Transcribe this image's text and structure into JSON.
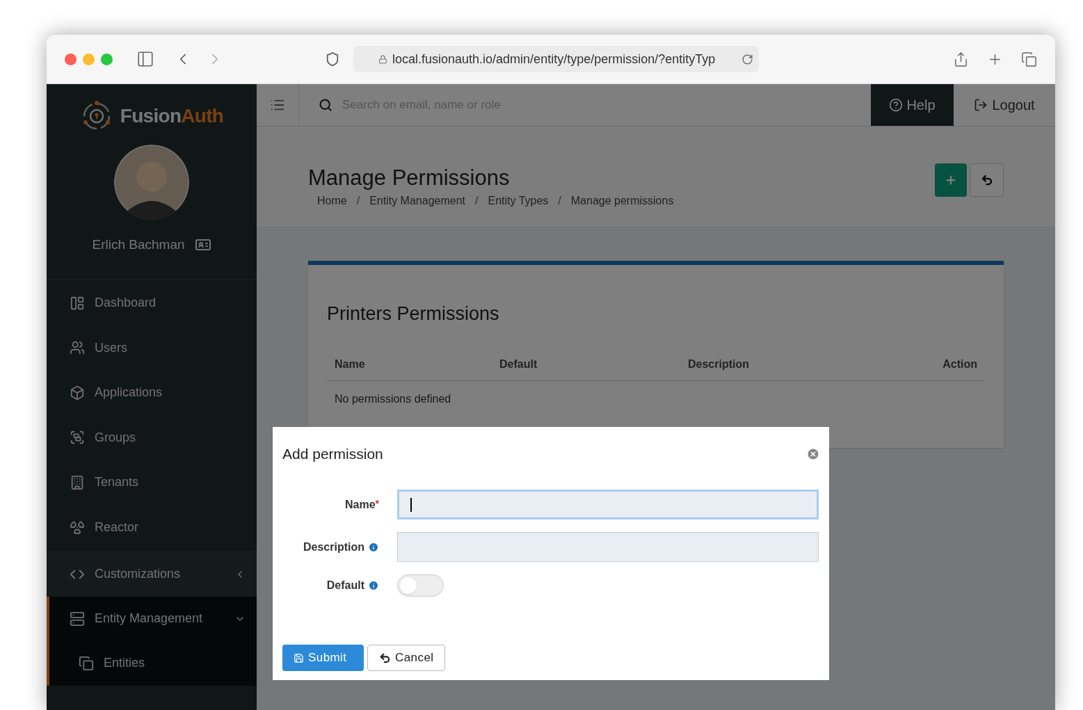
{
  "browser": {
    "url": "local.fusionauth.io/admin/entity/type/permission/?entityTyp"
  },
  "sidebar": {
    "brand": {
      "first": "Fusion",
      "second": "Auth"
    },
    "user_name": "Erlich Bachman",
    "items": [
      {
        "label": "Dashboard"
      },
      {
        "label": "Users"
      },
      {
        "label": "Applications"
      },
      {
        "label": "Groups"
      },
      {
        "label": "Tenants"
      },
      {
        "label": "Reactor"
      }
    ],
    "sections": [
      {
        "label": "Customizations",
        "expanded": false
      },
      {
        "label": "Entity Management",
        "expanded": true,
        "children": [
          {
            "label": "Entities"
          }
        ]
      }
    ]
  },
  "topbar": {
    "search": {
      "placeholder": "Search on email, name or role"
    },
    "help": "Help",
    "logout": "Logout"
  },
  "page": {
    "title": "Manage Permissions",
    "breadcrumbs": [
      "Home",
      "Entity Management",
      "Entity Types",
      "Manage permissions"
    ],
    "separator": "/"
  },
  "card": {
    "title": "Printers Permissions",
    "columns": [
      "Name",
      "Default",
      "Description",
      "Action"
    ],
    "empty_message": "No permissions defined"
  },
  "dialog": {
    "title": "Add permission",
    "fields": [
      {
        "kind": "text",
        "label": "Name",
        "required_mark": "*",
        "info": false,
        "focused": true
      },
      {
        "kind": "text",
        "label": "Description",
        "info": true,
        "focused": false
      },
      {
        "kind": "toggle",
        "label": "Default",
        "info": true,
        "on": false
      }
    ],
    "buttons": [
      {
        "kind": "primary",
        "label": "Submit"
      },
      {
        "kind": "secondary",
        "label": "Cancel"
      }
    ]
  }
}
